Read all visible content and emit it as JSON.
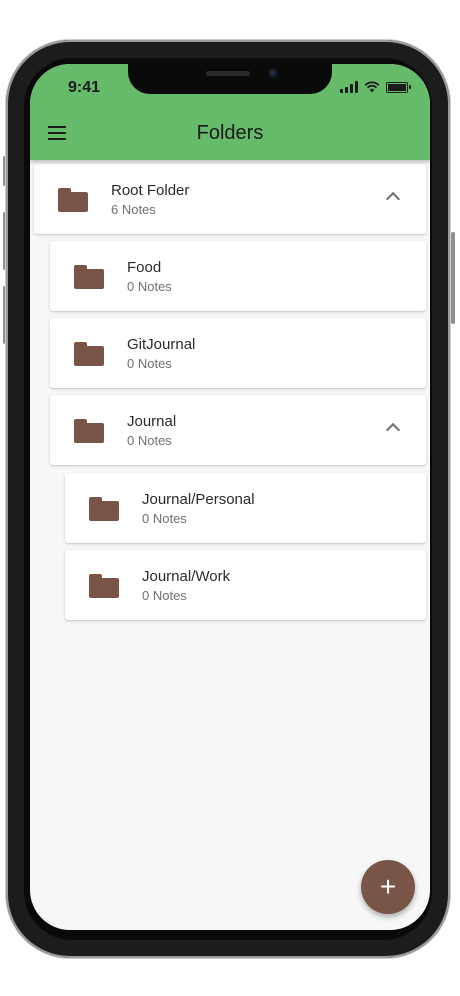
{
  "theme": {
    "accent": "#66bb6a",
    "folder": "#795548"
  },
  "status_bar": {
    "time": "9:41",
    "icons": [
      "signal-icon",
      "wifi-icon",
      "battery-icon"
    ]
  },
  "header": {
    "title": "Folders",
    "menu_icon": "hamburger-menu-icon"
  },
  "folders": [
    {
      "name": "Root Folder",
      "count": "6 Notes",
      "expanded": true
    },
    {
      "name": "Food",
      "count": "0 Notes"
    },
    {
      "name": "GitJournal",
      "count": "0 Notes"
    },
    {
      "name": "Journal",
      "count": "0 Notes",
      "expanded": true
    },
    {
      "name": "Journal/Personal",
      "count": "0 Notes"
    },
    {
      "name": "Journal/Work",
      "count": "0 Notes"
    }
  ],
  "fab": {
    "label": "+",
    "icon": "add-icon"
  }
}
